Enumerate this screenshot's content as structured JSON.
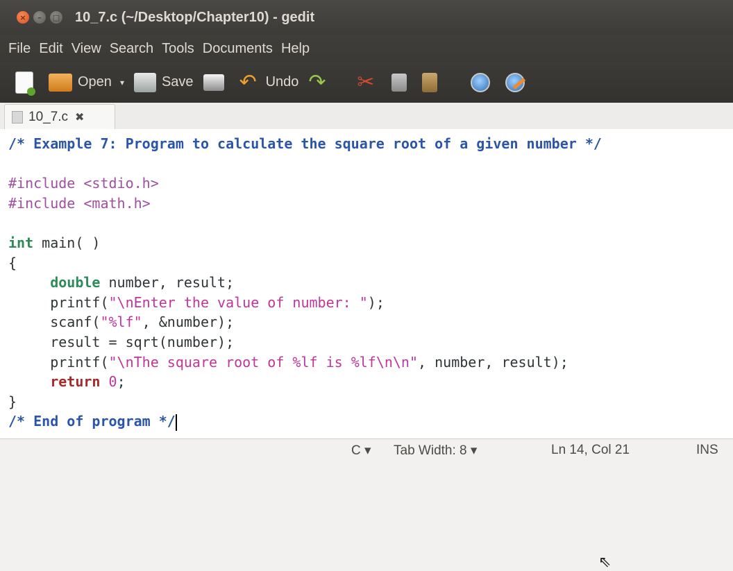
{
  "window": {
    "title": "10_7.c (~/Desktop/Chapter10) - gedit"
  },
  "menubar": {
    "items": [
      "File",
      "Edit",
      "View",
      "Search",
      "Tools",
      "Documents",
      "Help"
    ]
  },
  "toolbar": {
    "open_label": "Open",
    "save_label": "Save",
    "undo_label": "Undo",
    "icons": [
      "new-document-icon",
      "open-folder-icon",
      "save-icon",
      "print-icon",
      "undo-icon",
      "redo-icon",
      "cut-icon",
      "copy-icon",
      "paste-icon",
      "find-icon",
      "find-replace-icon"
    ]
  },
  "tab": {
    "label": "10_7.c"
  },
  "editor": {
    "lines": [
      "/* Example 7: Program to calculate the square root of a given number */",
      "",
      "#include <stdio.h>",
      "#include <math.h>",
      "",
      "int main( )",
      "{",
      "     double number, result;",
      "     printf(\"\\nEnter the value of number: \");",
      "     scanf(\"%lf\", &number);",
      "     result = sqrt(number);",
      "     printf(\"\\nThe square root of %lf is %lf\\n\\n\", number, result);",
      "     return 0;",
      "}",
      "/* End of program */"
    ]
  },
  "statusbar": {
    "language": "C",
    "tab_width": "Tab Width: 8",
    "position": "Ln 14, Col 21",
    "mode": "INS"
  },
  "colors": {
    "comment": "#2a55a8",
    "preprocessor": "#a04ea0",
    "type": "#2e8b57",
    "keyword": "#a52a2a",
    "string": "#c0359a",
    "titlebar": "#3c3b37"
  }
}
